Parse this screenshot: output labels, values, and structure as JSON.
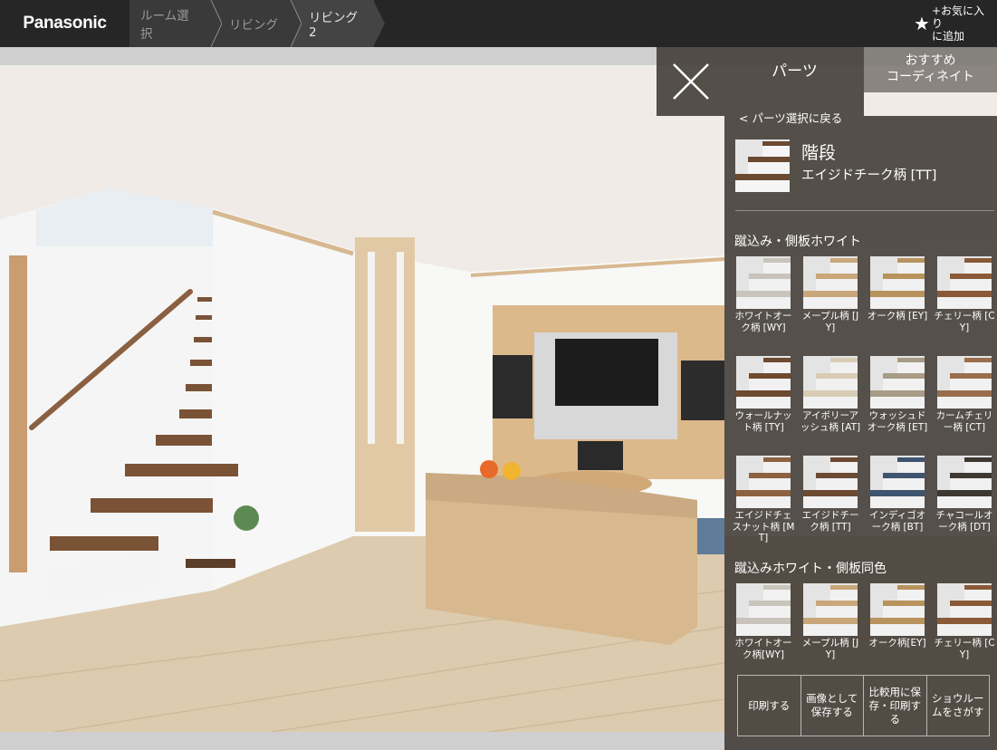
{
  "header": {
    "brand": "Panasonic",
    "breadcrumbs": [
      {
        "label": "ルーム選択"
      },
      {
        "label": "リビング"
      },
      {
        "label": "リビング2"
      }
    ],
    "favorite_line1": "+お気に入り",
    "favorite_line2": "に追加"
  },
  "tabs": {
    "parts": "パーツ",
    "recommend_line1": "おすすめ",
    "recommend_line2": "コーディネイト"
  },
  "panel": {
    "back": "< パーツ選択に戻る",
    "selected_title": "階段",
    "selected_name": "エイジドチーク柄 [TT]",
    "section1": "蹴込み・側板ホワイト",
    "section1_items": [
      {
        "label": "ホワイトオーク柄 [WY]",
        "tread": "#c9c4bb",
        "riser": "#f1f1f1"
      },
      {
        "label": "メープル柄 [JY]",
        "tread": "#c9a77a",
        "riser": "#f1f1f1"
      },
      {
        "label": "オーク柄 [EY]",
        "tread": "#b8935d",
        "riser": "#f1f1f1"
      },
      {
        "label": "チェリー柄 [CY]",
        "tread": "#8a5a38",
        "riser": "#f1f1f1"
      },
      {
        "label": "ウォールナット柄 [TY]",
        "tread": "#6e4a30",
        "riser": "#f1f1f1"
      },
      {
        "label": "アイボリーアッシュ柄 [AT]",
        "tread": "#d8ccb4",
        "riser": "#f1f1f1"
      },
      {
        "label": "ウォッシュドオーク柄 [ET]",
        "tread": "#a89c86",
        "riser": "#f1f1f1"
      },
      {
        "label": "カームチェリー柄 [CT]",
        "tread": "#9a6e4c",
        "riser": "#f1f1f1"
      },
      {
        "label": "エイジドチェスナット柄 [MT]",
        "tread": "#8c6242",
        "riser": "#f1f1f1"
      },
      {
        "label": "エイジドチーク柄 [TT]",
        "tread": "#6b4a32",
        "riser": "#f1f1f1"
      },
      {
        "label": "インディゴオーク柄 [BT]",
        "tread": "#3f5470",
        "riser": "#f1f1f1"
      },
      {
        "label": "チャコールオーク柄 [DT]",
        "tread": "#3e3833",
        "riser": "#f1f1f1"
      }
    ],
    "section2": "蹴込みホワイト・側板同色",
    "section2_items": [
      {
        "label": "ホワイトオーク柄[WY]",
        "tread": "#c9c4bb",
        "riser": "#f1f1f1"
      },
      {
        "label": "メープル柄 [JY]",
        "tread": "#c9a77a",
        "riser": "#f1f1f1"
      },
      {
        "label": "オーク柄[EY]",
        "tread": "#b8935d",
        "riser": "#f1f1f1"
      },
      {
        "label": "チェリー柄 [CY]",
        "tread": "#8a5a38",
        "riser": "#f1f1f1"
      }
    ],
    "actions": {
      "print": "印刷する",
      "save_image": "画像として保存する",
      "save_compare": "比較用に保存・印刷する",
      "showroom": "ショウルームをさがす"
    }
  }
}
